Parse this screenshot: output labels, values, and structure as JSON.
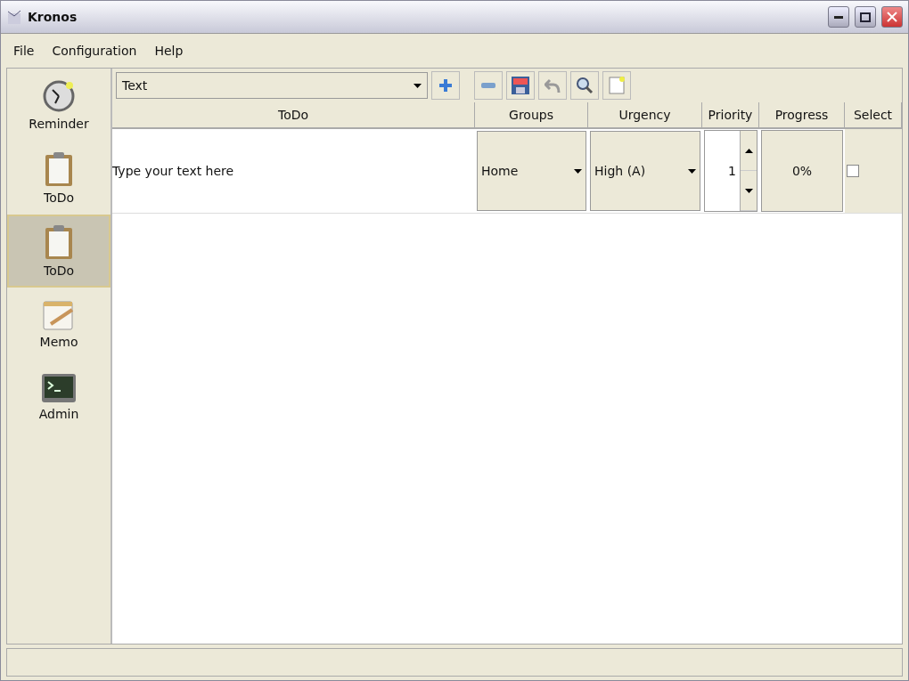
{
  "window": {
    "title": "Kronos"
  },
  "menu": [
    "File",
    "Configuration",
    "Help"
  ],
  "sidebar": {
    "items": [
      {
        "label": "Reminder",
        "kind": "clock",
        "selected": false
      },
      {
        "label": "ToDo",
        "kind": "clipboard",
        "selected": false
      },
      {
        "label": "ToDo",
        "kind": "clipboard",
        "selected": true
      },
      {
        "label": "Memo",
        "kind": "notepad",
        "selected": false
      },
      {
        "label": "Admin",
        "kind": "terminal",
        "selected": false
      }
    ]
  },
  "filter": {
    "value": "Text"
  },
  "table": {
    "columns": [
      "ToDo",
      "Groups",
      "Urgency",
      "Priority",
      "Progress",
      "Select"
    ],
    "rows": [
      {
        "todo": "Type your text here",
        "group": "Home",
        "urgency": "High (A)",
        "priority": "1",
        "progress": "0%",
        "checked": false
      }
    ]
  }
}
